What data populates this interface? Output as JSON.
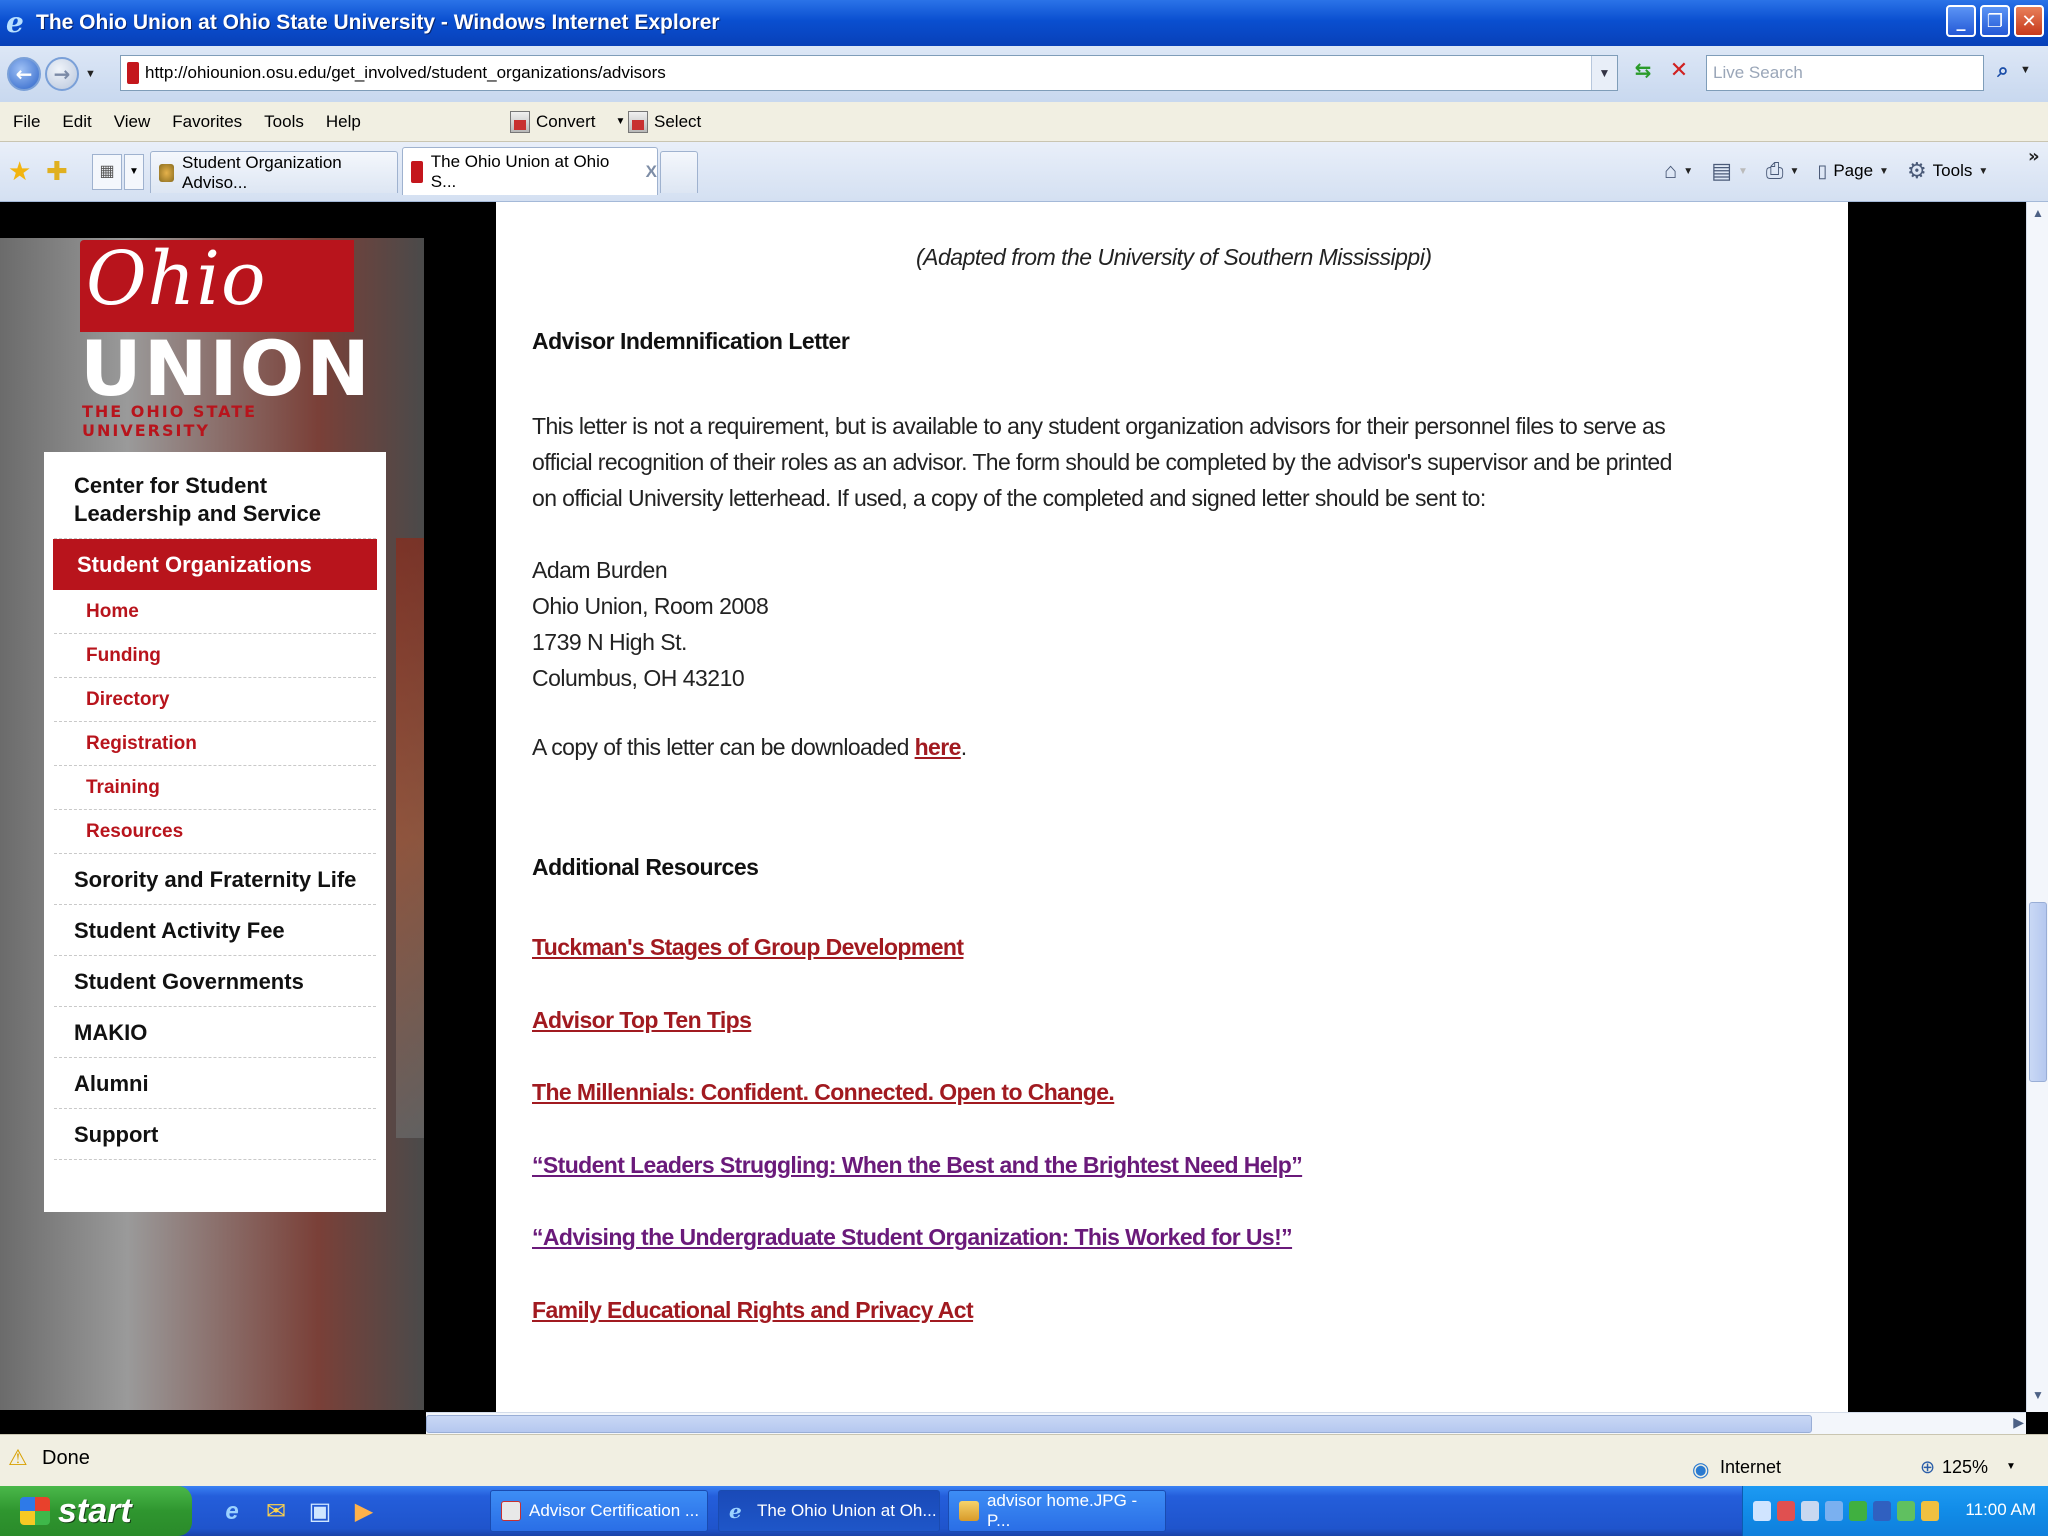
{
  "window": {
    "title": "The Ohio Union at Ohio State University - Windows Internet Explorer"
  },
  "address": {
    "url": "http://ohiounion.osu.edu/get_involved/student_organizations/advisors",
    "search_placeholder": "Live Search"
  },
  "menu": {
    "items": [
      "File",
      "Edit",
      "View",
      "Favorites",
      "Tools",
      "Help"
    ],
    "convert": "Convert",
    "select": "Select"
  },
  "tabs": {
    "tab1": "Student Organization Adviso...",
    "tab2": "The Ohio Union at Ohio S...",
    "close": "X"
  },
  "command_bar": {
    "page": "Page",
    "tools": "Tools"
  },
  "logo": {
    "ohio": "Ohio",
    "union": "UNION",
    "osu": "THE OHIO STATE UNIVERSITY"
  },
  "nav": {
    "center": "Center for Student Leadership and Service",
    "student_orgs": "Student Organizations",
    "sub": [
      "Home",
      "Funding",
      "Directory",
      "Registration",
      "Training",
      "Resources"
    ],
    "sorority": "Sorority and Fraternity Life",
    "activity_fee": "Student Activity Fee",
    "governments": "Student Governments",
    "makio": "MAKIO",
    "alumni": "Alumni",
    "support": "Support"
  },
  "content": {
    "adapted": "(Adapted from the University of Southern Mississippi)",
    "indemnification_heading": "Advisor Indemnification Letter",
    "indemnification_text": "This letter is not a requirement, but is available to any student organization advisors for their personnel files to serve as official recognition of their roles as an advisor. The form should be completed by the advisor's supervisor and be printed on official University letterhead. If used, a copy of the completed and signed letter should be sent to:",
    "address_lines": [
      "Adam Burden",
      "Ohio Union, Room 2008",
      "1739 N High St.",
      "Columbus, OH 43210"
    ],
    "download_prefix": "A copy of this letter can be downloaded ",
    "download_link": "here",
    "download_suffix": ".",
    "resources_heading": "Additional Resources",
    "resources": [
      "Tuckman's Stages of Group Development",
      "Advisor Top Ten Tips",
      "The Millennials: Confident. Connected. Open to Change.",
      "“Student Leaders Struggling: When the Best and the Brightest Need Help”",
      "“Advising the Undergraduate Student Organization: This Worked for Us!”",
      "Family Educational Rights and Privacy Act"
    ]
  },
  "status": {
    "text": "Done",
    "zone": "Internet",
    "zoom": "125%"
  },
  "taskbar": {
    "start": "start",
    "tasks": [
      "Advisor Certification ...",
      "The Ohio Union at Oh...",
      "advisor home.JPG - P..."
    ],
    "clock": "11:00 AM"
  },
  "colors": {
    "osu_red": "#b8141c",
    "link_red": "#a11a20",
    "visited_purple": "#6a1a7a"
  }
}
